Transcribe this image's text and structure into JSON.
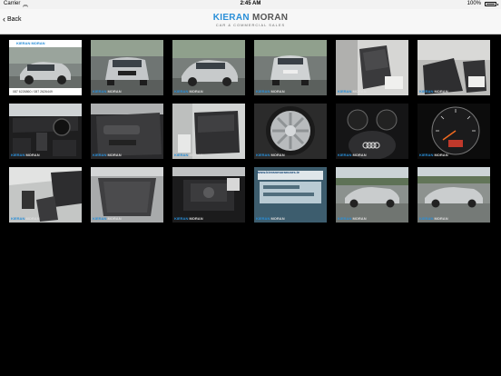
{
  "status_bar": {
    "carrier": "Carrier",
    "time": "2:45 AM",
    "battery": "100%"
  },
  "nav": {
    "back_label": "Back",
    "logo_line1_a": "KIERAN",
    "logo_line1_b": "MORAN",
    "logo_line2": "CAR & COMMERCIAL SALES"
  },
  "thumbnails": {
    "watermark_a": "KIERAN",
    "watermark_b": "MORAN",
    "first_header": "KIERAN MORAN",
    "first_footer": "087 6226860 / 087 2626449",
    "website": "www.kieranmorancars.ie"
  },
  "colors": {
    "brand_blue": "#2a8fd8",
    "background": "#000000"
  }
}
